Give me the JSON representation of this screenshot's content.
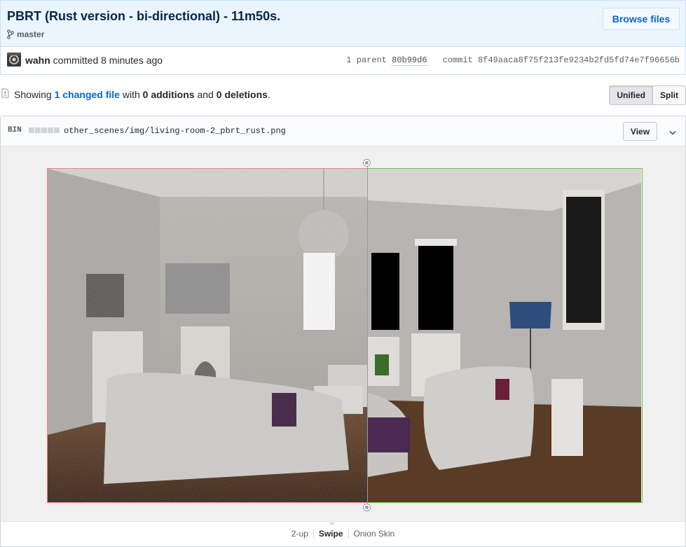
{
  "commit": {
    "title": "PBRT (Rust version - bi-directional) - 11m50s.",
    "branch": "master",
    "browse_label": "Browse files",
    "author": "wahn",
    "action_time": "committed 8 minutes ago",
    "parent_label": "1 parent",
    "parent_sha": "80b99d6",
    "commit_label": "commit",
    "commit_sha": "8f49aaca8f75f213fe9234b2fd5fd74e7f96656b"
  },
  "toc": {
    "showing": "Showing",
    "changed_link": "1 changed file",
    "with": "with",
    "additions": "0 additions",
    "and": "and",
    "deletions": "0 deletions",
    "period": ".",
    "unified_label": "Unified",
    "split_label": "Split"
  },
  "file": {
    "bin_label": "BIN",
    "path": "other_scenes/img/living-room-2_pbrt_rust.png",
    "view_label": "View",
    "swipe_position": 0.537
  },
  "image_modes": {
    "items": [
      "2-up",
      "Swipe",
      "Onion Skin"
    ],
    "active": "Swipe"
  },
  "icons": {
    "branch": "git-branch-icon",
    "toc": "file-diff-icon",
    "chevron": "chevron-down-icon"
  },
  "colors": {
    "title": "#05264c",
    "link": "#0366d6",
    "deleted_border": "#f0818c",
    "added_border": "#6cc644"
  }
}
